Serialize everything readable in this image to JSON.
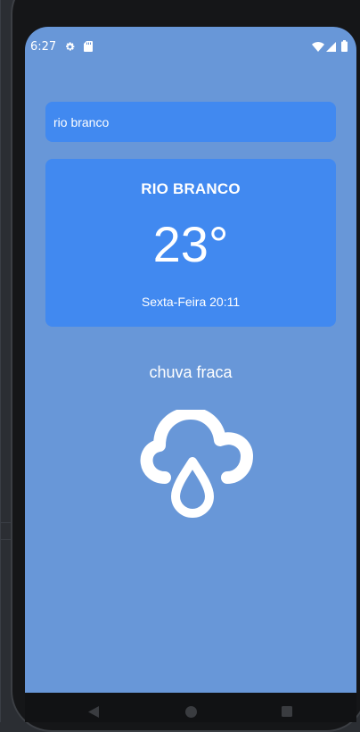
{
  "status_bar": {
    "time": "6:27",
    "left_icons": [
      "gear-icon",
      "sd-card-icon"
    ],
    "right_icons": [
      "wifi-icon",
      "cell-signal-icon",
      "battery-icon"
    ]
  },
  "search": {
    "value": "rio branco"
  },
  "weather_card": {
    "city": "RIO BRANCO",
    "temperature": "23°",
    "date_time": "Sexta-Feira 20:11"
  },
  "condition": {
    "description": "chuva fraca",
    "icon": "rain-cloud-icon"
  },
  "nav_bar": {
    "buttons": [
      "back-icon",
      "home-icon",
      "recents-icon"
    ]
  },
  "colors": {
    "screen_background": "#6897d8",
    "card_background": "#4189f0",
    "text": "#ffffff"
  }
}
